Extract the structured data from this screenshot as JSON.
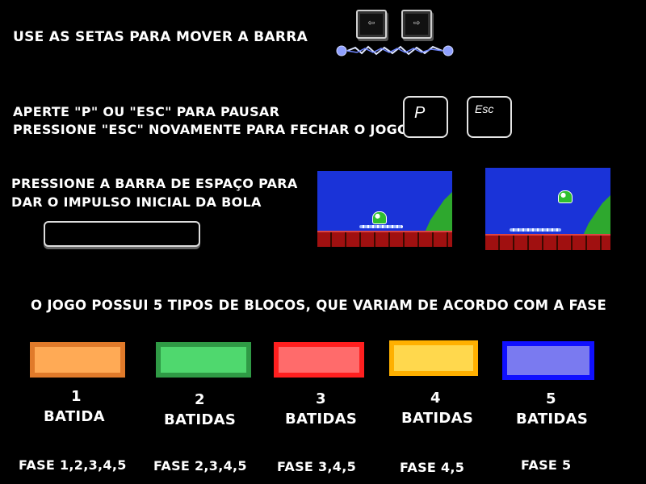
{
  "controls": {
    "move_text": "Use as setas para mover a barra",
    "left_key_glyph": "⇦",
    "right_key_glyph": "⇨",
    "pause_line1": "Aperte \"P\" ou \"Esc\" para pausar",
    "pause_line2": "Pressione \"Esc\" novamente para fechar o jogo",
    "key_p_label": "P",
    "key_esc_label": "Esc",
    "space_line1": "Pressione a barra de espaço para",
    "space_line2": "dar o impulso inicial da bola"
  },
  "blocks_heading": "O jogo possui 5 tipos de blocos, que variam de acordo com a fase",
  "blocks": [
    {
      "count": "1",
      "hits_label": "Batida",
      "phase": "Fase 1,2,3,4,5",
      "fill": "#ffaa55",
      "border": "#e07a2a"
    },
    {
      "count": "2",
      "hits_label": "Batidas",
      "phase": "Fase 2,3,4,5",
      "fill": "#4fd86e",
      "border": "#2f9a45"
    },
    {
      "count": "3",
      "hits_label": "Batidas",
      "phase": "Fase 3,4,5",
      "fill": "#ff6b6b",
      "border": "#ff1f1f"
    },
    {
      "count": "4",
      "hits_label": "Batidas",
      "phase": "Fase 4,5",
      "fill": "#ffd84d",
      "border": "#ffb000"
    },
    {
      "count": "5",
      "hits_label": "Batidas",
      "phase": "Fase 5",
      "fill": "#7a7af0",
      "border": "#1010ff"
    }
  ]
}
